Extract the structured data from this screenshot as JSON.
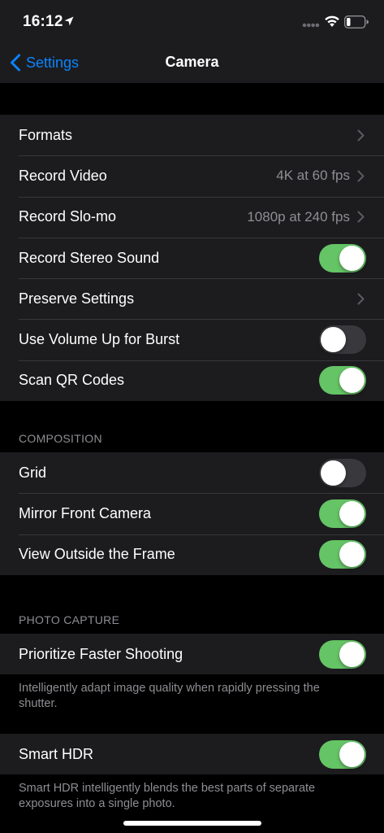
{
  "status_bar": {
    "time": "16:12"
  },
  "nav": {
    "back_label": "Settings",
    "title": "Camera"
  },
  "group_main": {
    "formats": {
      "label": "Formats"
    },
    "record_video": {
      "label": "Record Video",
      "value": "4K at 60 fps"
    },
    "record_slomo": {
      "label": "Record Slo-mo",
      "value": "1080p at 240 fps"
    },
    "record_stereo": {
      "label": "Record Stereo Sound",
      "on": true
    },
    "preserve_settings": {
      "label": "Preserve Settings"
    },
    "volume_burst": {
      "label": "Use Volume Up for Burst",
      "on": false
    },
    "scan_qr": {
      "label": "Scan QR Codes",
      "on": true
    }
  },
  "composition": {
    "header": "COMPOSITION",
    "grid": {
      "label": "Grid",
      "on": false
    },
    "mirror_front": {
      "label": "Mirror Front Camera",
      "on": true
    },
    "view_outside": {
      "label": "View Outside the Frame",
      "on": true
    }
  },
  "photo_capture": {
    "header": "PHOTO CAPTURE",
    "prioritize": {
      "label": "Prioritize Faster Shooting",
      "on": true
    },
    "prioritize_footer": "Intelligently adapt image quality when rapidly pressing the shutter.",
    "smart_hdr": {
      "label": "Smart HDR",
      "on": true
    },
    "smart_hdr_footer": "Smart HDR intelligently blends the best parts of separate exposures into a single photo."
  },
  "colors": {
    "accent": "#0a84ff",
    "toggle_on": "#65c466",
    "toggle_off": "#39393d",
    "cell_background": "#1c1c1e",
    "page_background": "#000000",
    "secondary_text": "#8e8e93"
  }
}
